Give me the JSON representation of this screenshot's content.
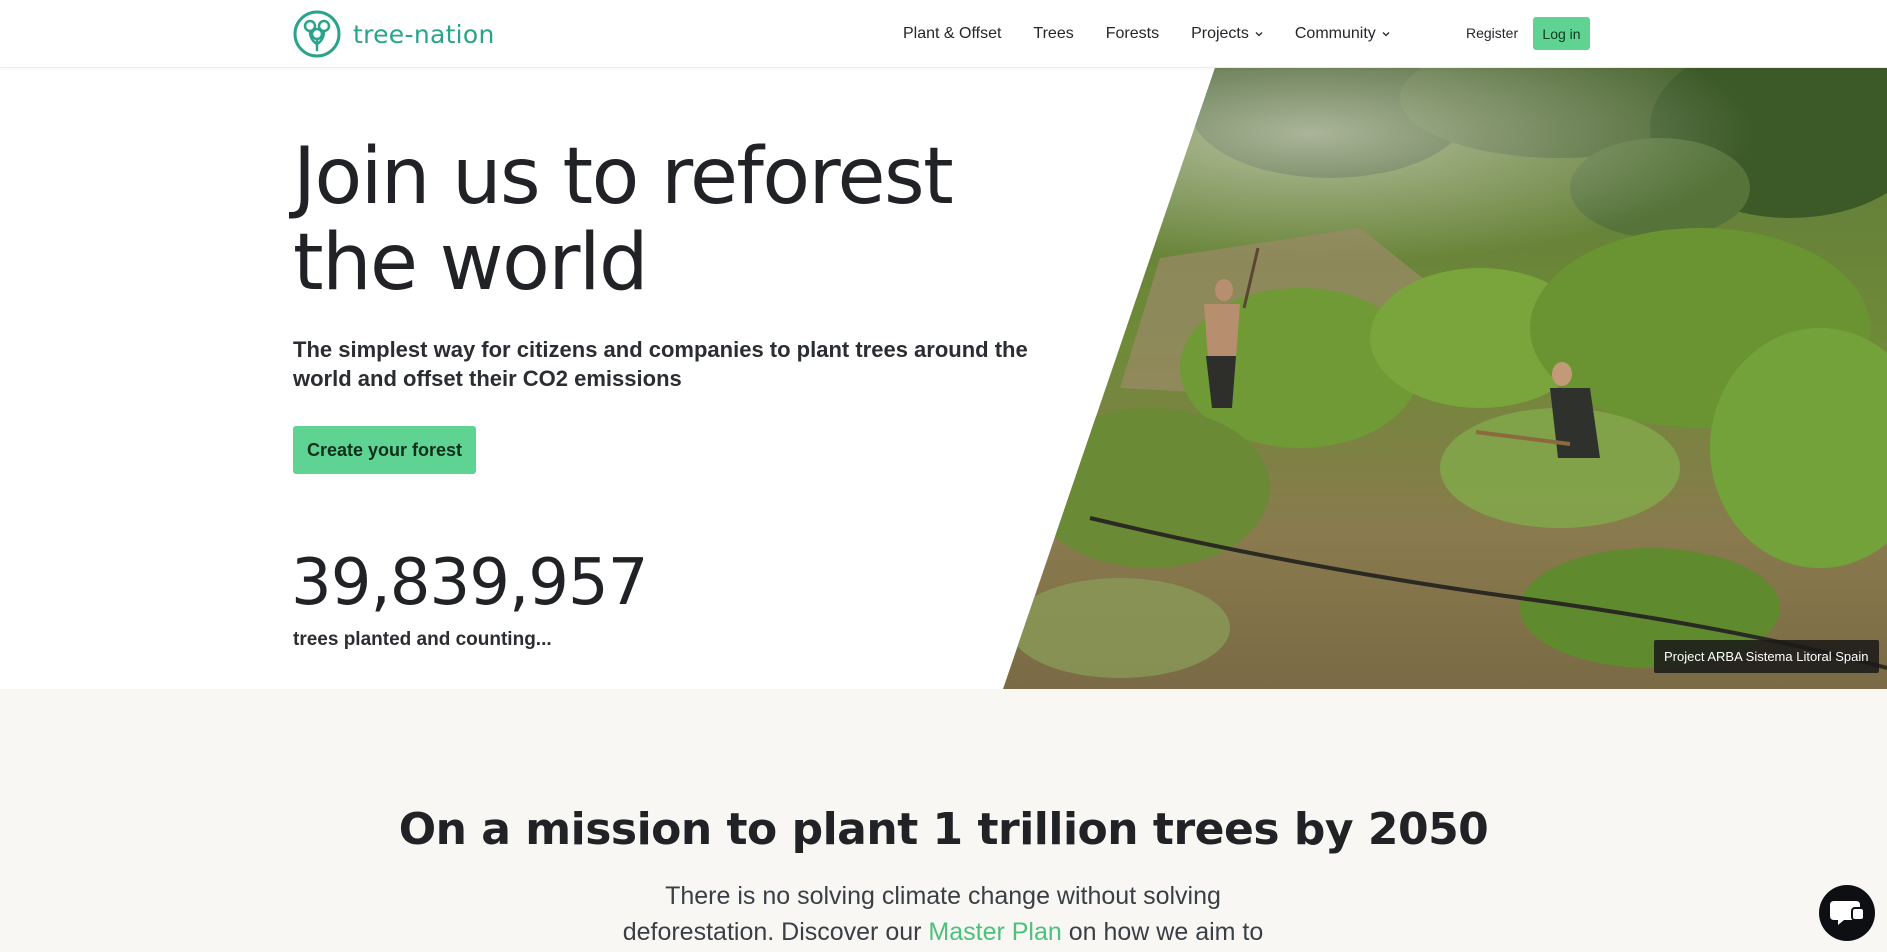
{
  "brand": {
    "name": "tree-nation",
    "primary_color": "#2ba38a",
    "button_color": "#5fd392"
  },
  "nav": {
    "items": [
      {
        "label": "Plant & Offset",
        "dropdown": false
      },
      {
        "label": "Trees",
        "dropdown": false
      },
      {
        "label": "Forests",
        "dropdown": false
      },
      {
        "label": "Projects",
        "dropdown": true
      },
      {
        "label": "Community",
        "dropdown": true
      }
    ],
    "register_label": "Register",
    "login_label": "Log in"
  },
  "hero": {
    "title_line1": "Join us to reforest",
    "title_line2": "the world",
    "subtitle": "The simplest way for citizens and companies to plant trees around the world and offset their CO2 emissions",
    "cta_label": "Create your forest",
    "counter": "39,839,957",
    "counter_label": "trees planted and counting...",
    "photo_caption": "Project ARBA Sistema Litoral Spain"
  },
  "mission": {
    "title": "On a mission to plant 1 trillion trees by 2050",
    "text_part1": "There is no solving climate change without solving deforestation. Discover our ",
    "link_label": "Master Plan",
    "text_part2": " on how we aim to"
  },
  "icons": {
    "logo": "tree-logo-icon",
    "chevron": "chevron-down-icon",
    "chat": "chat-bubble-icon"
  }
}
